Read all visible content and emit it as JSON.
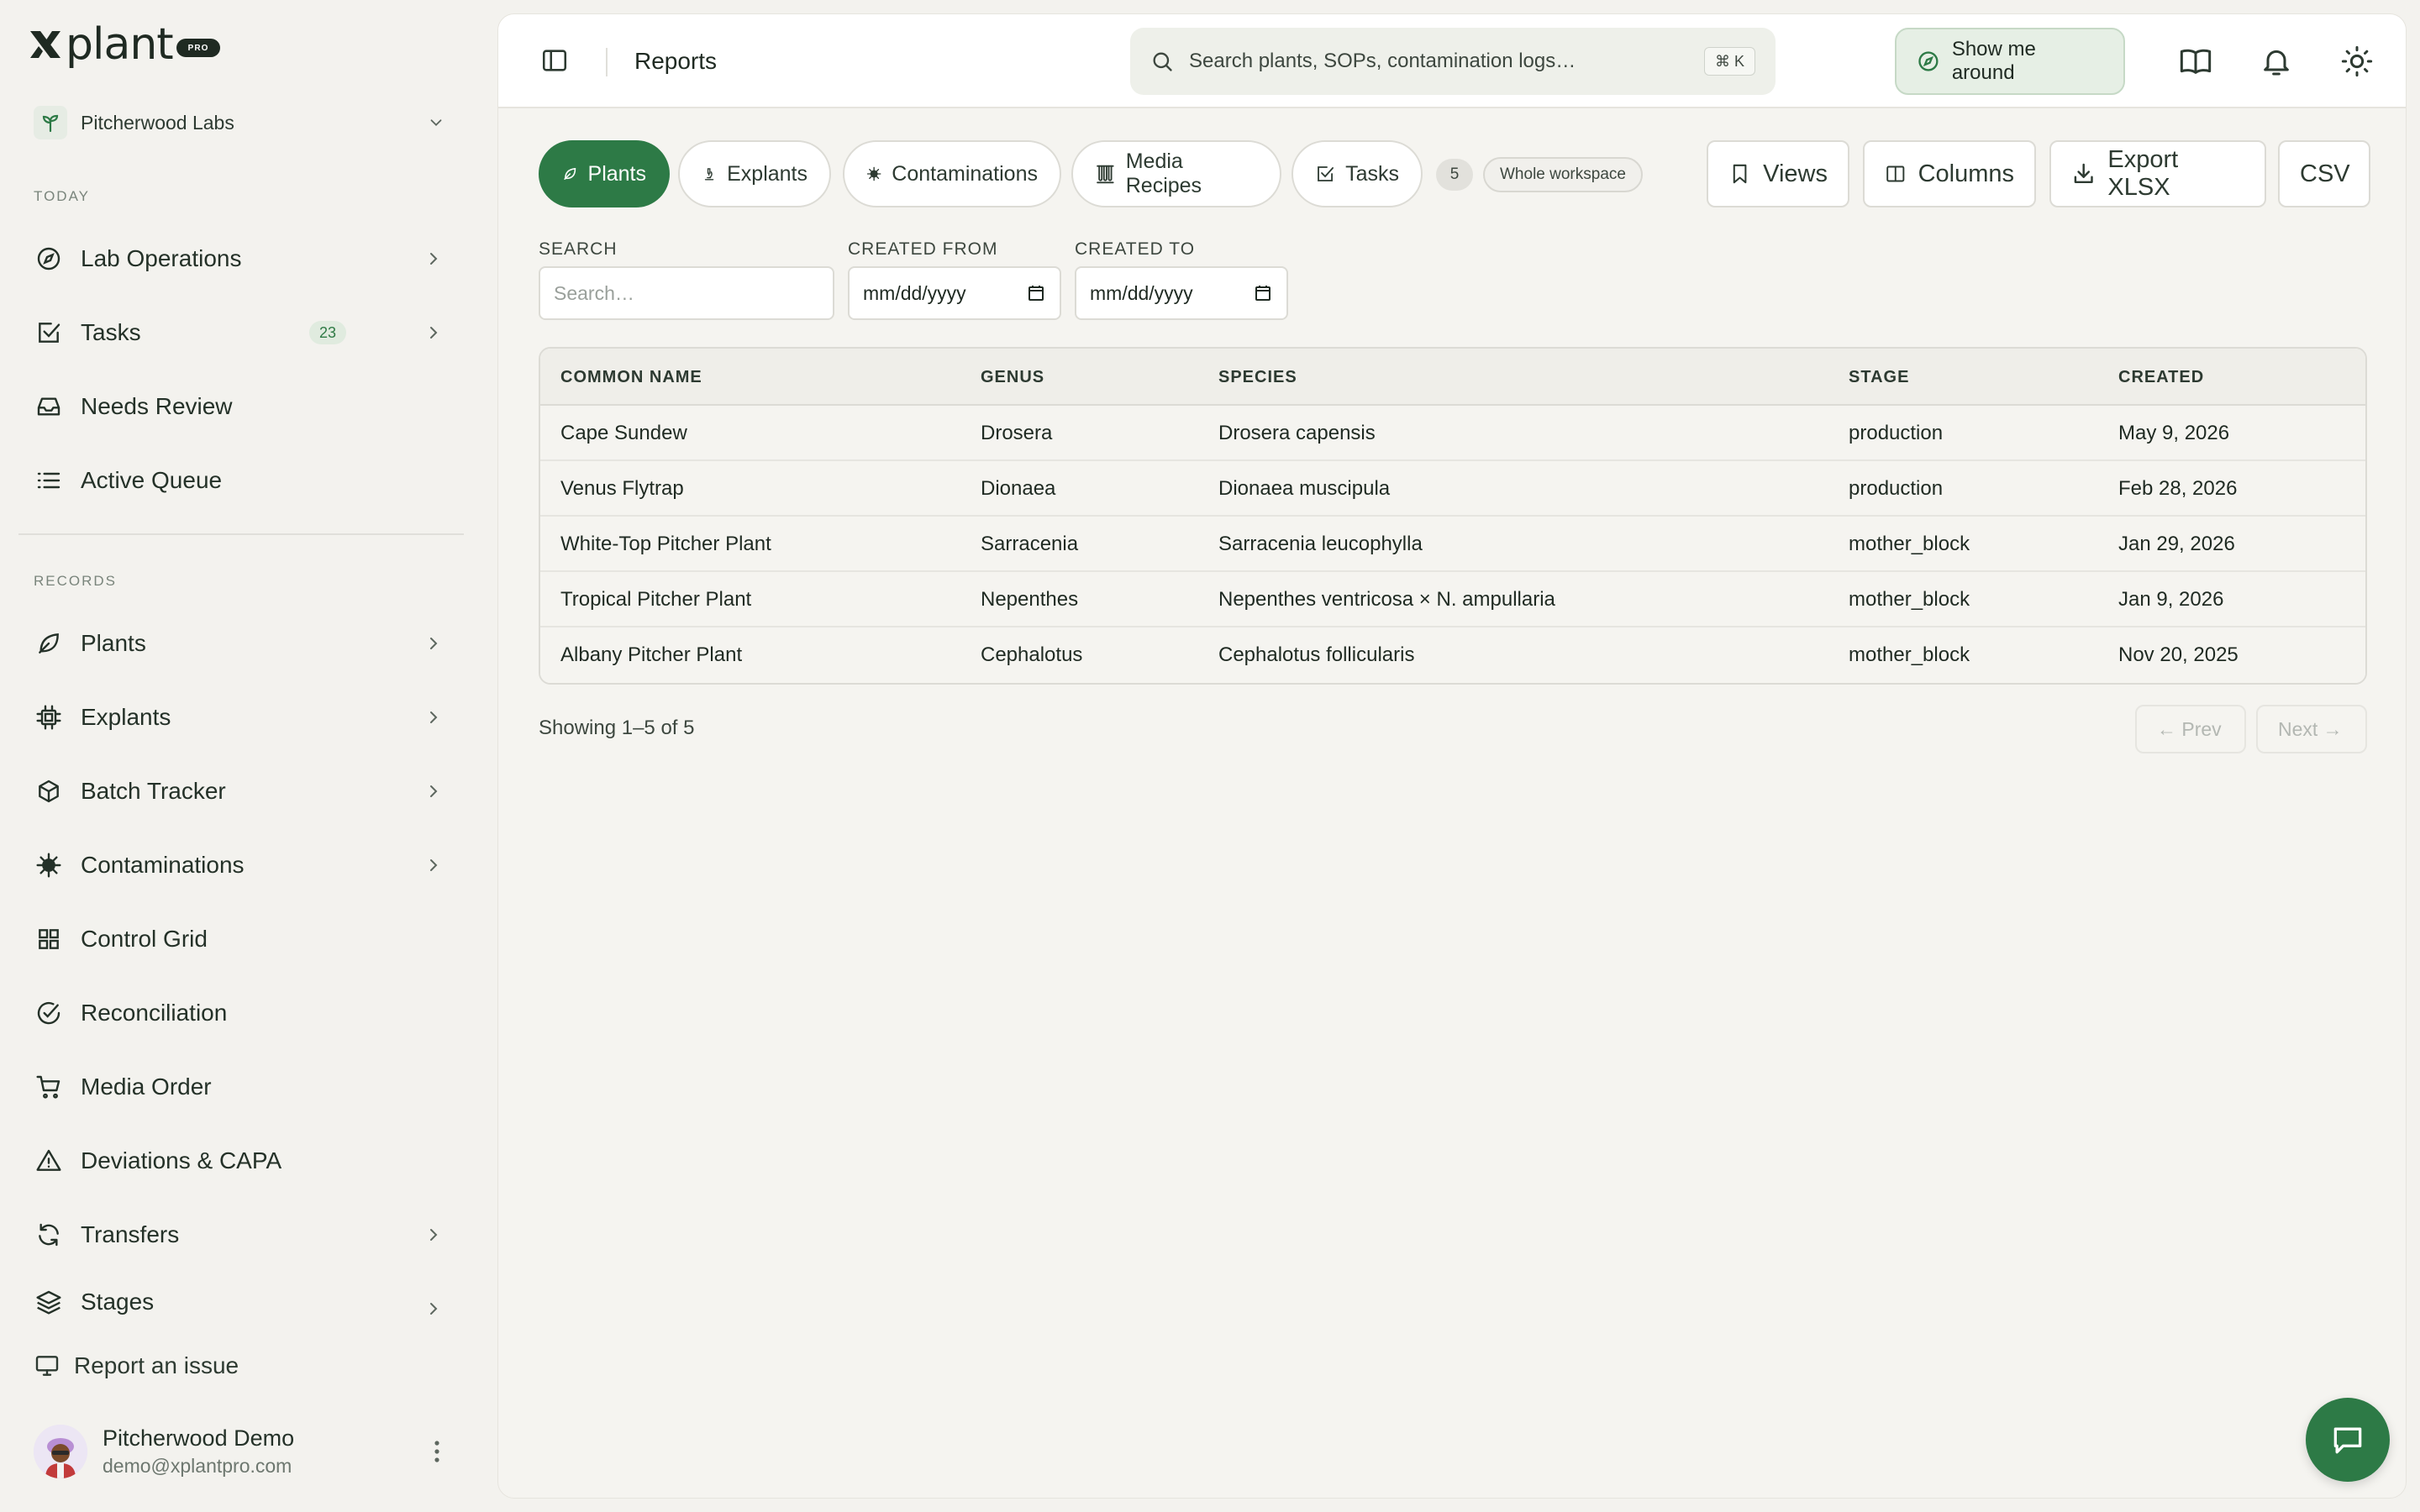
{
  "brand": {
    "name": "plant",
    "badge": "PRO"
  },
  "org": {
    "name": "Pitcherwood Labs"
  },
  "sidebar": {
    "today_label": "TODAY",
    "records_label": "RECORDS",
    "today_items": [
      {
        "label": "Lab Operations"
      },
      {
        "label": "Tasks",
        "badge": "23"
      },
      {
        "label": "Needs Review"
      },
      {
        "label": "Active Queue"
      }
    ],
    "records_items": [
      {
        "label": "Plants"
      },
      {
        "label": "Explants"
      },
      {
        "label": "Batch Tracker"
      },
      {
        "label": "Contaminations"
      },
      {
        "label": "Control Grid"
      },
      {
        "label": "Reconciliation"
      },
      {
        "label": "Media Order"
      },
      {
        "label": "Deviations & CAPA"
      },
      {
        "label": "Transfers"
      },
      {
        "label": "Stages"
      }
    ],
    "report_issue": "Report an issue"
  },
  "user": {
    "name": "Pitcherwood Demo",
    "email": "demo@xplantpro.com"
  },
  "topbar": {
    "title": "Reports",
    "search_placeholder": "Search plants, SOPs, contamination logs…",
    "search_shortcut": "⌘ K",
    "tour_label": "Show me around"
  },
  "tabs": [
    {
      "label": "Plants",
      "active": true
    },
    {
      "label": "Explants"
    },
    {
      "label": "Contaminations"
    },
    {
      "label": "Media Recipes"
    },
    {
      "label": "Tasks"
    }
  ],
  "tab_count": "5",
  "scope": "Whole workspace",
  "actions": {
    "views": "Views",
    "columns": "Columns",
    "export_xlsx": "Export XLSX",
    "csv": "CSV"
  },
  "filters": {
    "search_label": "SEARCH",
    "search_placeholder": "Search…",
    "from_label": "CREATED FROM",
    "from_value": "mm/dd/yyyy",
    "to_label": "CREATED TO",
    "to_value": "mm/dd/yyyy"
  },
  "table": {
    "columns": [
      "COMMON NAME",
      "GENUS",
      "SPECIES",
      "STAGE",
      "CREATED"
    ],
    "rows": [
      [
        "Cape Sundew",
        "Drosera",
        "Drosera capensis",
        "production",
        "May 9, 2026"
      ],
      [
        "Venus Flytrap",
        "Dionaea",
        "Dionaea muscipula",
        "production",
        "Feb 28, 2026"
      ],
      [
        "White-Top Pitcher Plant",
        "Sarracenia",
        "Sarracenia leucophylla",
        "mother_block",
        "Jan 29, 2026"
      ],
      [
        "Tropical Pitcher Plant",
        "Nepenthes",
        "Nepenthes ventricosa × N. ampullaria",
        "mother_block",
        "Jan 9, 2026"
      ],
      [
        "Albany Pitcher Plant",
        "Cephalotus",
        "Cephalotus follicularis",
        "mother_block",
        "Nov 20, 2025"
      ]
    ]
  },
  "pagination": {
    "showing": "Showing 1–5 of 5",
    "prev": "← Prev",
    "next": "Next →"
  },
  "colors": {
    "accent": "#2d7a46",
    "background": "#f3f2ee",
    "surface": "#ffffff"
  }
}
